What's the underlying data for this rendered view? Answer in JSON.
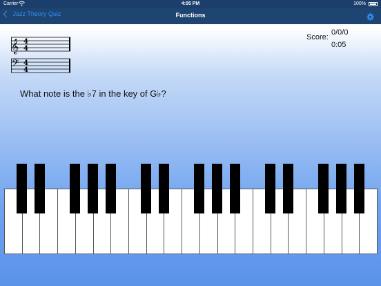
{
  "status_bar": {
    "carrier": "Carrier",
    "wifi_icon": "wifi-icon",
    "time": "4:05 PM",
    "battery": "100%",
    "battery_icon": "battery-icon"
  },
  "nav": {
    "back_label": "Jazz Theory Quiz",
    "back_icon": "chevron-left-icon",
    "title": "Functions",
    "settings_icon": "gear-icon"
  },
  "staff": {
    "treble_time_signature": [
      "4",
      "4"
    ],
    "bass_time_signature": [
      "4",
      "4"
    ]
  },
  "score": {
    "label": "Score:",
    "value": "0/0/0",
    "time": "0:05"
  },
  "question": "What note is the ♭7 in the key of G♭?",
  "keyboard": {
    "white_key_count": 21,
    "black_key_count": 15
  },
  "colors": {
    "nav_background": "#1e4472",
    "link_blue": "#2f8ff5",
    "background_top": "#c4d9f7",
    "background_bottom": "#5b93ea"
  }
}
